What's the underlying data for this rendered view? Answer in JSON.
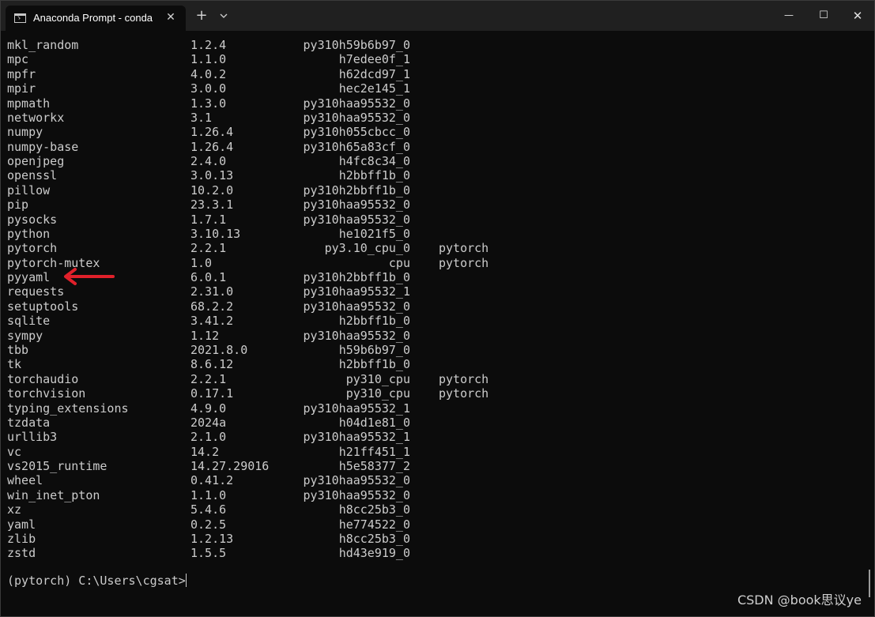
{
  "window": {
    "tab_title": "Anaconda Prompt - conda",
    "tab_close": "✕",
    "new_tab": "+",
    "minimize": "—",
    "maximize": "☐",
    "close": "✕"
  },
  "packages": [
    {
      "name": "mkl_random",
      "version": "1.2.4",
      "build": "py310h59b6b97_0",
      "channel": ""
    },
    {
      "name": "mpc",
      "version": "1.1.0",
      "build": "h7edee0f_1",
      "channel": ""
    },
    {
      "name": "mpfr",
      "version": "4.0.2",
      "build": "h62dcd97_1",
      "channel": ""
    },
    {
      "name": "mpir",
      "version": "3.0.0",
      "build": "hec2e145_1",
      "channel": ""
    },
    {
      "name": "mpmath",
      "version": "1.3.0",
      "build": "py310haa95532_0",
      "channel": ""
    },
    {
      "name": "networkx",
      "version": "3.1",
      "build": "py310haa95532_0",
      "channel": ""
    },
    {
      "name": "numpy",
      "version": "1.26.4",
      "build": "py310h055cbcc_0",
      "channel": ""
    },
    {
      "name": "numpy-base",
      "version": "1.26.4",
      "build": "py310h65a83cf_0",
      "channel": ""
    },
    {
      "name": "openjpeg",
      "version": "2.4.0",
      "build": "h4fc8c34_0",
      "channel": ""
    },
    {
      "name": "openssl",
      "version": "3.0.13",
      "build": "h2bbff1b_0",
      "channel": ""
    },
    {
      "name": "pillow",
      "version": "10.2.0",
      "build": "py310h2bbff1b_0",
      "channel": ""
    },
    {
      "name": "pip",
      "version": "23.3.1",
      "build": "py310haa95532_0",
      "channel": ""
    },
    {
      "name": "pysocks",
      "version": "1.7.1",
      "build": "py310haa95532_0",
      "channel": ""
    },
    {
      "name": "python",
      "version": "3.10.13",
      "build": "he1021f5_0",
      "channel": ""
    },
    {
      "name": "pytorch",
      "version": "2.2.1",
      "build": "py3.10_cpu_0",
      "channel": "pytorch"
    },
    {
      "name": "pytorch-mutex",
      "version": "1.0",
      "build": "cpu",
      "channel": "pytorch"
    },
    {
      "name": "pyyaml",
      "version": "6.0.1",
      "build": "py310h2bbff1b_0",
      "channel": ""
    },
    {
      "name": "requests",
      "version": "2.31.0",
      "build": "py310haa95532_1",
      "channel": ""
    },
    {
      "name": "setuptools",
      "version": "68.2.2",
      "build": "py310haa95532_0",
      "channel": ""
    },
    {
      "name": "sqlite",
      "version": "3.41.2",
      "build": "h2bbff1b_0",
      "channel": ""
    },
    {
      "name": "sympy",
      "version": "1.12",
      "build": "py310haa95532_0",
      "channel": ""
    },
    {
      "name": "tbb",
      "version": "2021.8.0",
      "build": "h59b6b97_0",
      "channel": ""
    },
    {
      "name": "tk",
      "version": "8.6.12",
      "build": "h2bbff1b_0",
      "channel": ""
    },
    {
      "name": "torchaudio",
      "version": "2.2.1",
      "build": "py310_cpu",
      "channel": "pytorch"
    },
    {
      "name": "torchvision",
      "version": "0.17.1",
      "build": "py310_cpu",
      "channel": "pytorch"
    },
    {
      "name": "typing_extensions",
      "version": "4.9.0",
      "build": "py310haa95532_1",
      "channel": ""
    },
    {
      "name": "tzdata",
      "version": "2024a",
      "build": "h04d1e81_0",
      "channel": ""
    },
    {
      "name": "urllib3",
      "version": "2.1.0",
      "build": "py310haa95532_1",
      "channel": ""
    },
    {
      "name": "vc",
      "version": "14.2",
      "build": "h21ff451_1",
      "channel": ""
    },
    {
      "name": "vs2015_runtime",
      "version": "14.27.29016",
      "build": "h5e58377_2",
      "channel": ""
    },
    {
      "name": "wheel",
      "version": "0.41.2",
      "build": "py310haa95532_0",
      "channel": ""
    },
    {
      "name": "win_inet_pton",
      "version": "1.1.0",
      "build": "py310haa95532_0",
      "channel": ""
    },
    {
      "name": "xz",
      "version": "5.4.6",
      "build": "h8cc25b3_0",
      "channel": ""
    },
    {
      "name": "yaml",
      "version": "0.2.5",
      "build": "he774522_0",
      "channel": ""
    },
    {
      "name": "zlib",
      "version": "1.2.13",
      "build": "h8cc25b3_0",
      "channel": ""
    },
    {
      "name": "zstd",
      "version": "1.5.5",
      "build": "hd43e919_0",
      "channel": ""
    }
  ],
  "prompt": "(pytorch) C:\\Users\\cgsat>",
  "watermark": "CSDN @book思议ye",
  "colors": {
    "background": "#0c0c0c",
    "text": "#cccccc",
    "titlebar": "#202020",
    "arrow": "#e0202a"
  }
}
